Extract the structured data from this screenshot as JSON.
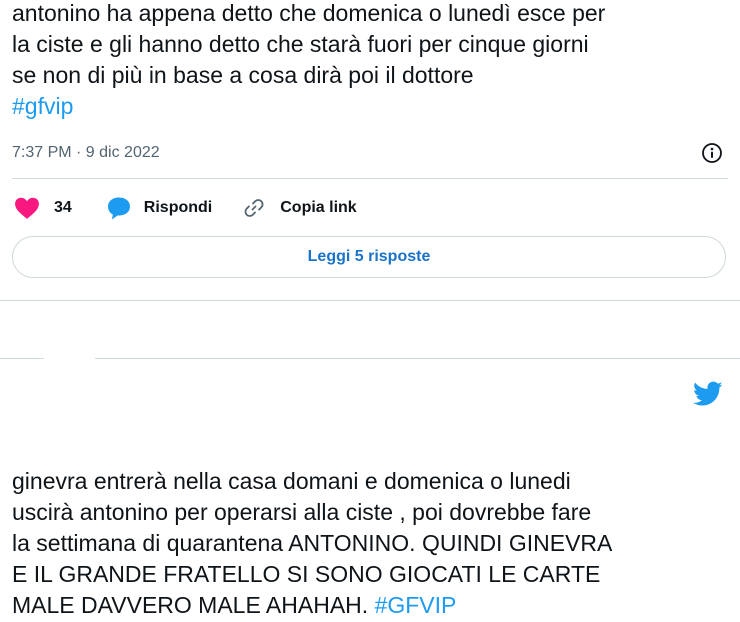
{
  "tweet1": {
    "lines": [
      "antonino ha appena detto che domenica o lunedì esce per",
      "la ciste e gli hanno detto che starà fuori per cinque giorni",
      "se non di più in base a cosa dirà poi il dottore"
    ],
    "hashtag": "#gfvip",
    "timestamp": "7:37 PM · 9 dic 2022",
    "like_count": "34",
    "reply_label": "Rispondi",
    "copy_link_label": "Copia link",
    "read_replies_label": "Leggi 5 risposte"
  },
  "tweet2": {
    "lines": [
      "ginevra entrerà nella casa domani e domenica o lunedi",
      "uscirà antonino per operarsi alla ciste , poi dovrebbe fare",
      "la settimana di quarantena ANTONINO. QUINDI GINEVRA",
      "E IL GRANDE FRATELLO SI SONO  GIOCATI LE CARTE"
    ],
    "last_line_text": "MALE DAVVERO MALE AHAHAH. ",
    "hashtag": "#GFVIP"
  },
  "icons": {
    "like": "heart-icon",
    "reply": "speech-bubble-icon",
    "copy": "link-icon",
    "info": "info-icon",
    "brand": "twitter-bird-icon"
  },
  "colors": {
    "like": "#f91880",
    "reply": "#1d9bf0",
    "link": "#1d9bf0",
    "brand": "#1d9bf0",
    "button_text": "#1a73c9",
    "border": "#cfd9de",
    "muted": "#536471"
  }
}
